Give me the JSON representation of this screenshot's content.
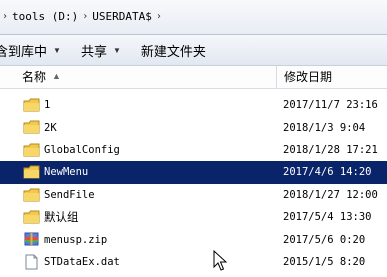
{
  "address": {
    "parts": [
      "tools (D:)",
      "USERDATA$"
    ]
  },
  "toolbar": {
    "include_label": "包含到库中",
    "share_label": "共享",
    "new_folder_label": "新建文件夹"
  },
  "columns": {
    "name": "名称",
    "date": "修改日期"
  },
  "files": [
    {
      "name": "1",
      "date": "2017/11/7 23:16",
      "type": "folder"
    },
    {
      "name": "2K",
      "date": "2018/1/3 9:04",
      "type": "folder"
    },
    {
      "name": "GlobalConfig",
      "date": "2018/1/28 17:21",
      "type": "folder"
    },
    {
      "name": "NewMenu",
      "date": "2017/4/6 14:20",
      "type": "folder",
      "selected": true
    },
    {
      "name": "SendFile",
      "date": "2018/1/27 12:00",
      "type": "folder"
    },
    {
      "name": "默认组",
      "date": "2017/5/4 13:30",
      "type": "folder"
    },
    {
      "name": "menusp.zip",
      "date": "2017/5/6 0:20",
      "type": "zip"
    },
    {
      "name": "STDataEx.dat",
      "date": "2015/1/5 8:20",
      "type": "dat"
    }
  ],
  "colors": {
    "selection": "#0a246a",
    "folder": "#f2c94c"
  }
}
